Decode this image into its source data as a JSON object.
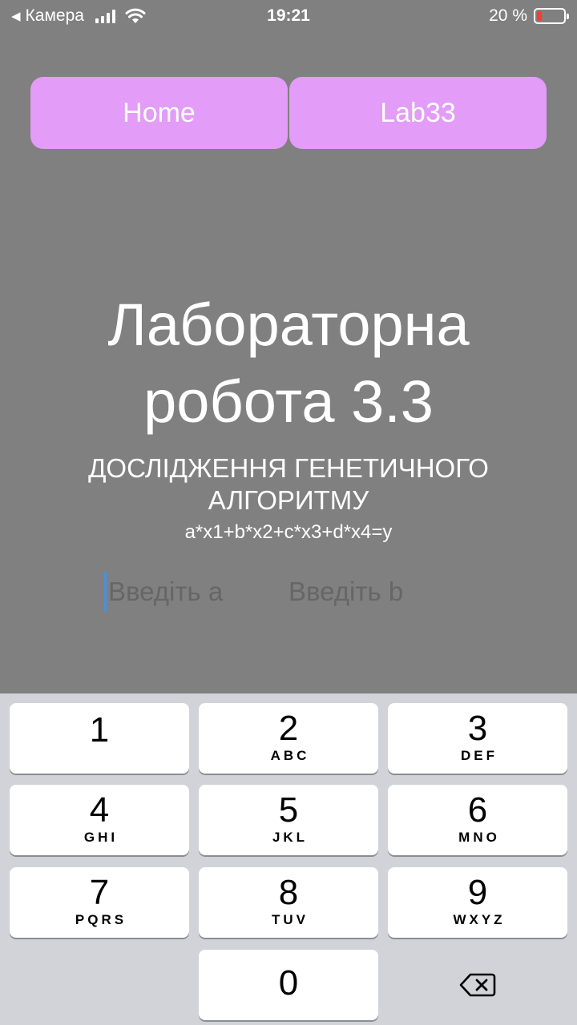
{
  "status_bar": {
    "back_label": "Камера",
    "time": "19:21",
    "battery_text": "20 %",
    "battery_level": 0.2,
    "battery_color": "#ff3b30"
  },
  "nav": {
    "home_label": "Home",
    "lab_label": "Lab33",
    "button_color": "#e39cf7"
  },
  "content": {
    "title_line1": "Лабораторна",
    "title_line2": "робота 3.3",
    "subtitle_line1": "ДОСЛІДЖЕННЯ ГЕНЕТИЧНОГО",
    "subtitle_line2": "АЛГОРИТМУ",
    "formula": "a*x1+b*x2+c*x3+d*x4=y"
  },
  "inputs": {
    "a_placeholder": "Введіть a",
    "b_placeholder": "Введіть b"
  },
  "keyboard": {
    "keys": [
      {
        "num": "1",
        "letters": ""
      },
      {
        "num": "2",
        "letters": "ABC"
      },
      {
        "num": "3",
        "letters": "DEF"
      },
      {
        "num": "4",
        "letters": "GHI"
      },
      {
        "num": "5",
        "letters": "JKL"
      },
      {
        "num": "6",
        "letters": "MNO"
      },
      {
        "num": "7",
        "letters": "PQRS"
      },
      {
        "num": "8",
        "letters": "TUV"
      },
      {
        "num": "9",
        "letters": "WXYZ"
      },
      {
        "num": "0",
        "letters": ""
      }
    ],
    "backspace_icon": "backspace-icon"
  }
}
